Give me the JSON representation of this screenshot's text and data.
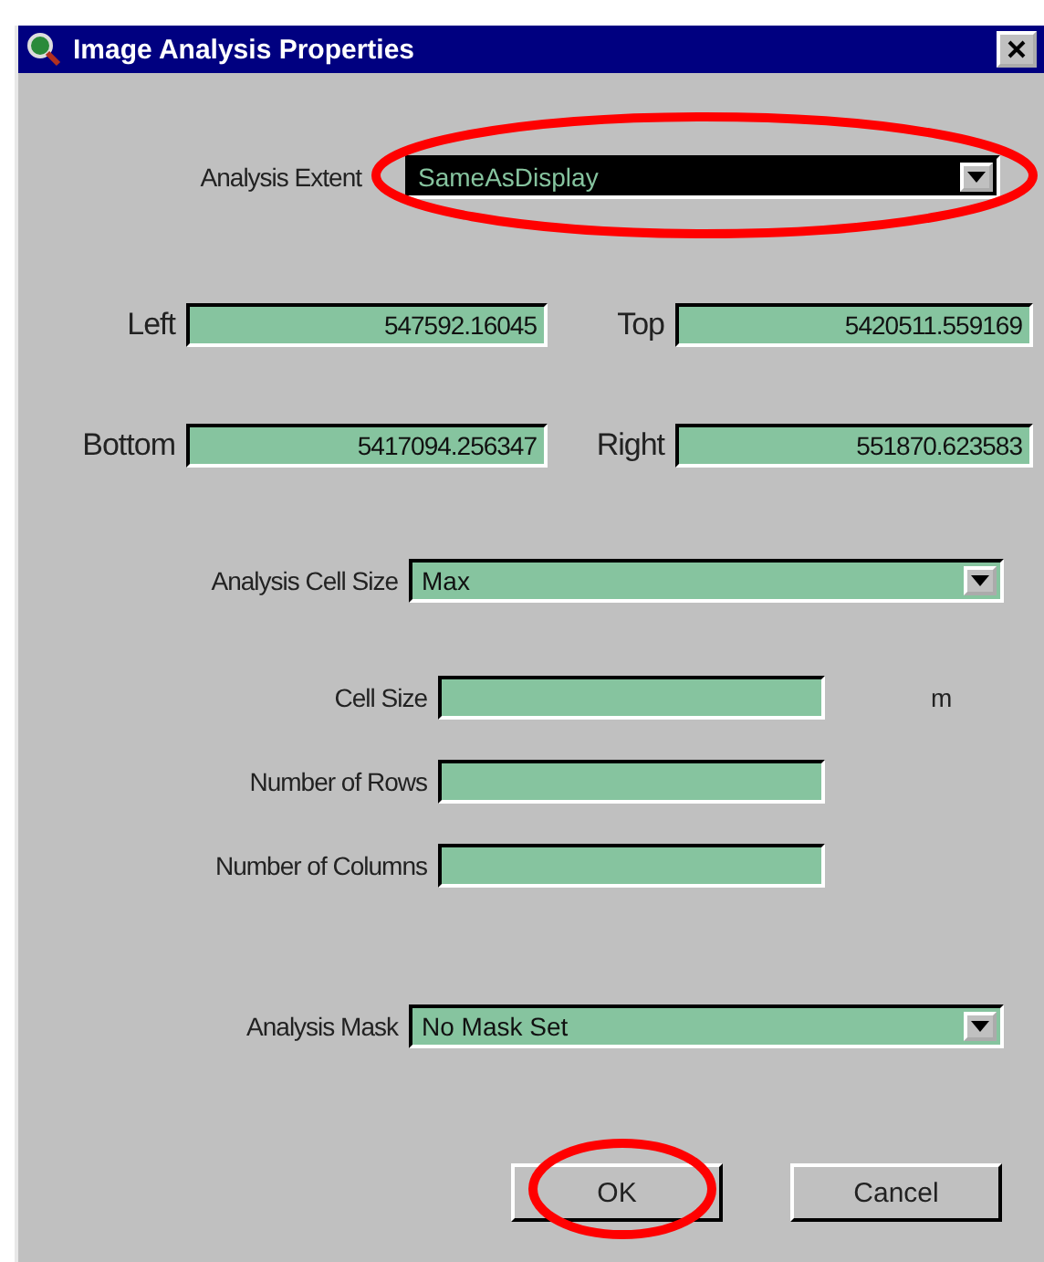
{
  "window": {
    "title": "Image Analysis Properties"
  },
  "extent": {
    "label": "Analysis Extent",
    "value": "SameAsDisplay",
    "focused": true
  },
  "bounds": [
    {
      "label": "Left",
      "value": "547592.16045"
    },
    {
      "label": "Top",
      "value": "5420511.559169"
    },
    {
      "label": "Bottom",
      "value": "5417094.256347"
    },
    {
      "label": "Right",
      "value": "551870.623583"
    }
  ],
  "cell_size_select": {
    "label": "Analysis Cell Size",
    "value": "Max",
    "focused": false
  },
  "cell_fields": [
    {
      "label": "Cell Size",
      "unit": "m"
    },
    {
      "label": "Number of Rows"
    },
    {
      "label": "Number of Columns"
    }
  ],
  "mask": {
    "label": "Analysis Mask",
    "value": "No Mask Set",
    "focused": false
  },
  "buttons": [
    {
      "label": "OK",
      "circled": true
    },
    {
      "label": "Cancel",
      "circled": false
    }
  ]
}
